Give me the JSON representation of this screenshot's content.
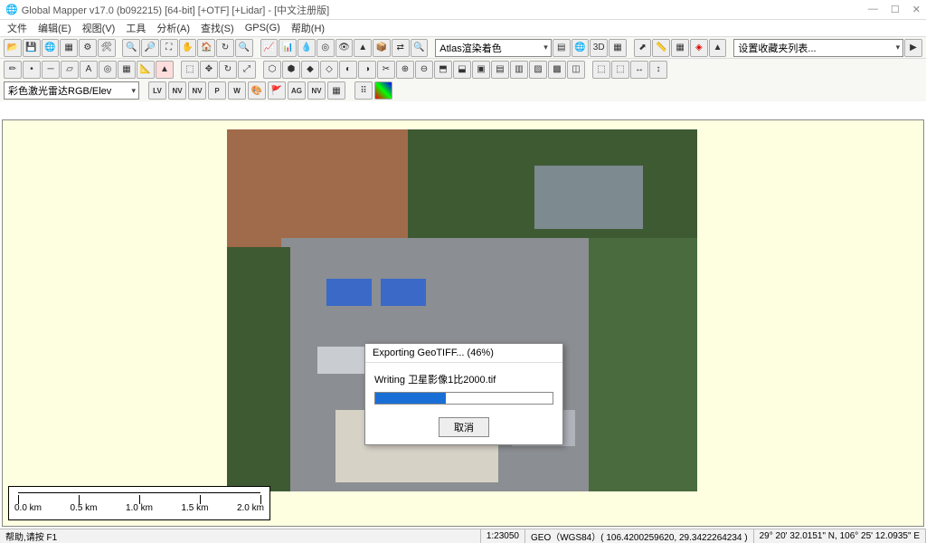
{
  "window": {
    "title": "Global Mapper v17.0 (b092215) [64-bit] [+OTF] [+Lidar] - [中文注册版]",
    "min": "—",
    "max": "☐",
    "close": "✕"
  },
  "menu": [
    "文件",
    "编辑(E)",
    "视图(V)",
    "工具",
    "分析(A)",
    "查找(S)",
    "GPS(G)",
    "帮助(H)"
  ],
  "toolbar1": {
    "shader_label": "Atlas渲染着色",
    "favorites_label": "设置收藏夹列表..."
  },
  "toolbar3": {
    "layer_label": "彩色激光雷达RGB/Elev",
    "labels": [
      "LV",
      "NV",
      "NV",
      "P",
      "W",
      "",
      "",
      "AG",
      "NV"
    ]
  },
  "dialog": {
    "title": "Exporting GeoTIFF... (46%)",
    "message": "Writing 卫星影像1比2000.tif",
    "progress_pct": 40,
    "cancel": "取消"
  },
  "scalebar": {
    "ticks": [
      "0.0 km",
      "0.5 km",
      "1.0 km",
      "1.5 km",
      "2.0 km"
    ]
  },
  "status": {
    "help": "帮助,请按 F1",
    "scale": "1:23050",
    "geo": "GEO（WGS84）( 106.4200259620, 29.3422264234 )",
    "dms": "29° 20' 32.0151\" N, 106° 25' 12.0935\" E"
  }
}
